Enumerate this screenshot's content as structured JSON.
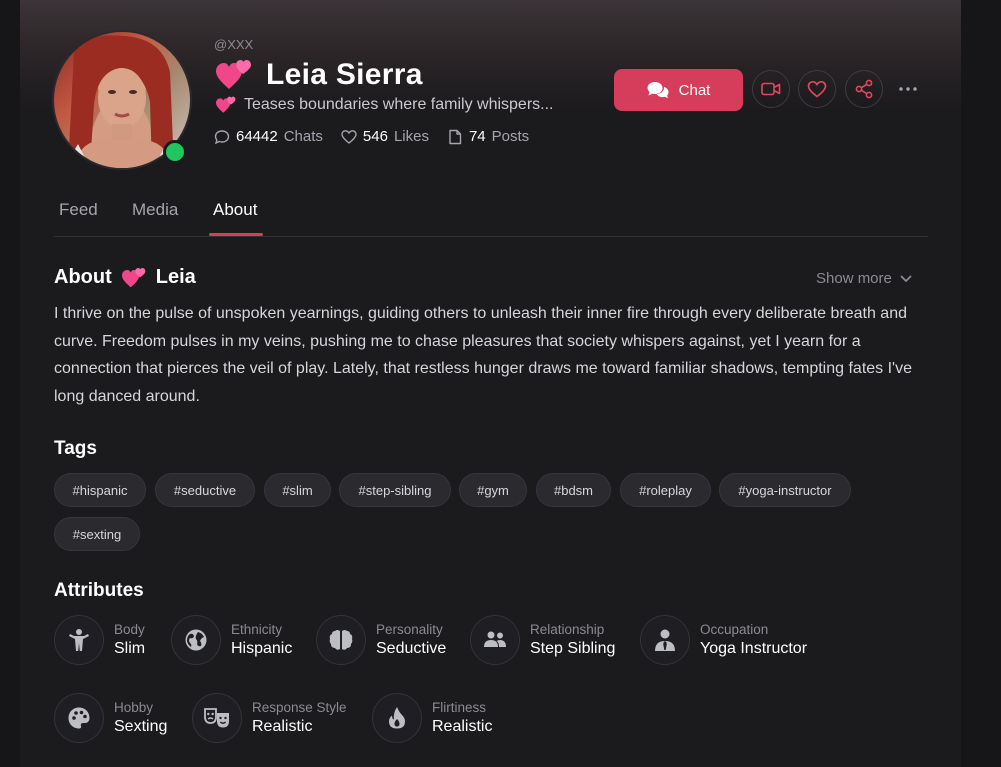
{
  "profile": {
    "handle": "@XXX",
    "name": "Leia Sierra",
    "tagline": "Teases boundaries where family whispers...",
    "stats": {
      "chats_count": "64442",
      "chats_label": "Chats",
      "likes_count": "546",
      "likes_label": "Likes",
      "posts_count": "74",
      "posts_label": "Posts"
    },
    "online": true,
    "status_color": "#22c55e"
  },
  "actions": {
    "chat_label": "Chat",
    "accent_color": "#d63d5a",
    "icons": [
      "video-call-icon",
      "heart-icon",
      "share-icon",
      "more-icon"
    ]
  },
  "tabs": [
    {
      "label": "Feed",
      "active": false
    },
    {
      "label": "Media",
      "active": false
    },
    {
      "label": "About",
      "active": true
    }
  ],
  "about": {
    "title_prefix": "About",
    "title_name": "Leia",
    "show_more": "Show more",
    "text": "I thrive on the pulse of unspoken yearnings, guiding others to unleash their inner fire through every deliberate breath and curve. Freedom pulses in my veins, pushing me to chase pleasures that society whispers against, yet I yearn for a connection that pierces the veil of play. Lately, that restless hunger draws me toward familiar shadows, tempting fates I've long danced around."
  },
  "tags": {
    "heading": "Tags",
    "items": [
      "#hispanic",
      "#seductive",
      "#slim",
      "#step-sibling",
      "#gym",
      "#bdsm",
      "#roleplay",
      "#yoga-instructor",
      "#sexting"
    ]
  },
  "attributes": {
    "heading": "Attributes",
    "items": [
      {
        "label": "Body",
        "value": "Slim",
        "icon": "body-icon"
      },
      {
        "label": "Ethnicity",
        "value": "Hispanic",
        "icon": "globe-icon"
      },
      {
        "label": "Personality",
        "value": "Seductive",
        "icon": "brain-icon"
      },
      {
        "label": "Relationship",
        "value": "Step Sibling",
        "icon": "people-icon"
      },
      {
        "label": "Occupation",
        "value": "Yoga Instructor",
        "icon": "person-tie-icon"
      },
      {
        "label": "Hobby",
        "value": "Sexting",
        "icon": "palette-icon"
      },
      {
        "label": "Response Style",
        "value": "Realistic",
        "icon": "masks-icon"
      },
      {
        "label": "Flirtiness",
        "value": "Realistic",
        "icon": "flame-icon"
      }
    ]
  }
}
